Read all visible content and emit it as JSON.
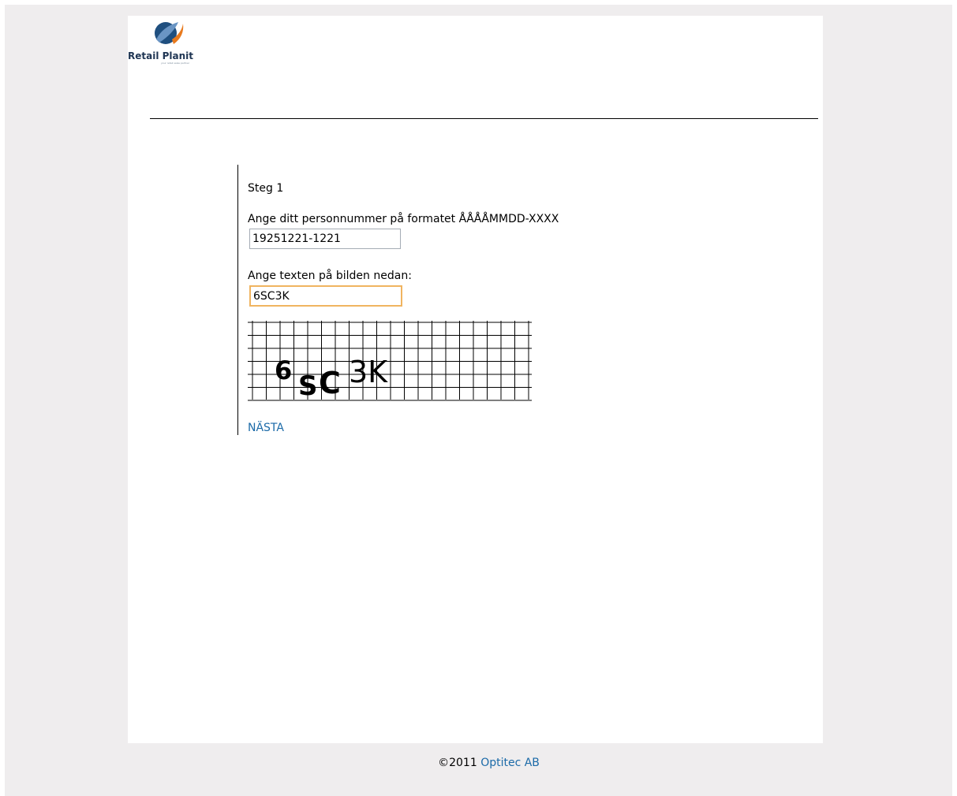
{
  "brand": {
    "name": "Retail Planit",
    "tagline": "your retail sales partner"
  },
  "form": {
    "step_title": "Steg 1",
    "personnummer_label": "Ange ditt personnummer på formatet ÅÅÅÅMMDD-XXXX",
    "personnummer_value": "19251221-1221",
    "captcha_label": "Ange texten på bilden nedan:",
    "captcha_value": "6SC3K",
    "captcha_image_text": [
      "6",
      "S",
      "C",
      "3K"
    ],
    "next_label": "NÄSTA"
  },
  "footer": {
    "copyright": "©2011",
    "company_link": "Optitec AB"
  },
  "colors": {
    "link": "#1b6aa8",
    "focus_border": "#f0b460",
    "background": "#efedee",
    "logo_blue": "#1f3553",
    "logo_orange": "#e87a1e"
  }
}
